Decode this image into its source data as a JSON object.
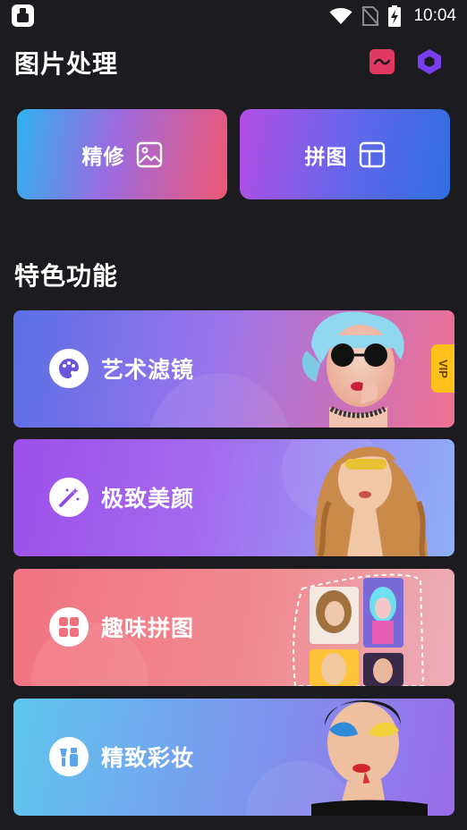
{
  "status_bar": {
    "time": "10:04",
    "icons": [
      "app-notification-icon",
      "wifi-icon",
      "no-sim-icon",
      "battery-charging-icon"
    ]
  },
  "header": {
    "title": "图片处理",
    "actions": [
      "gallery-icon",
      "settings-hexagon-icon"
    ]
  },
  "quick_actions": [
    {
      "label": "精修",
      "icon": "image-icon"
    },
    {
      "label": "拼图",
      "icon": "layout-icon"
    }
  ],
  "features": {
    "title": "特色功能",
    "items": [
      {
        "label": "艺术滤镜",
        "icon": "palette-icon",
        "badge": "VIP"
      },
      {
        "label": "极致美颜",
        "icon": "magic-wand-icon"
      },
      {
        "label": "趣味拼图",
        "icon": "grid-icon"
      },
      {
        "label": "精致彩妆",
        "icon": "makeup-brush-icon"
      }
    ]
  },
  "colors": {
    "background": "#1c1b1f",
    "accent_purple": "#7c3aed",
    "accent_pink": "#e8416a",
    "vip": "#ffc21a"
  }
}
